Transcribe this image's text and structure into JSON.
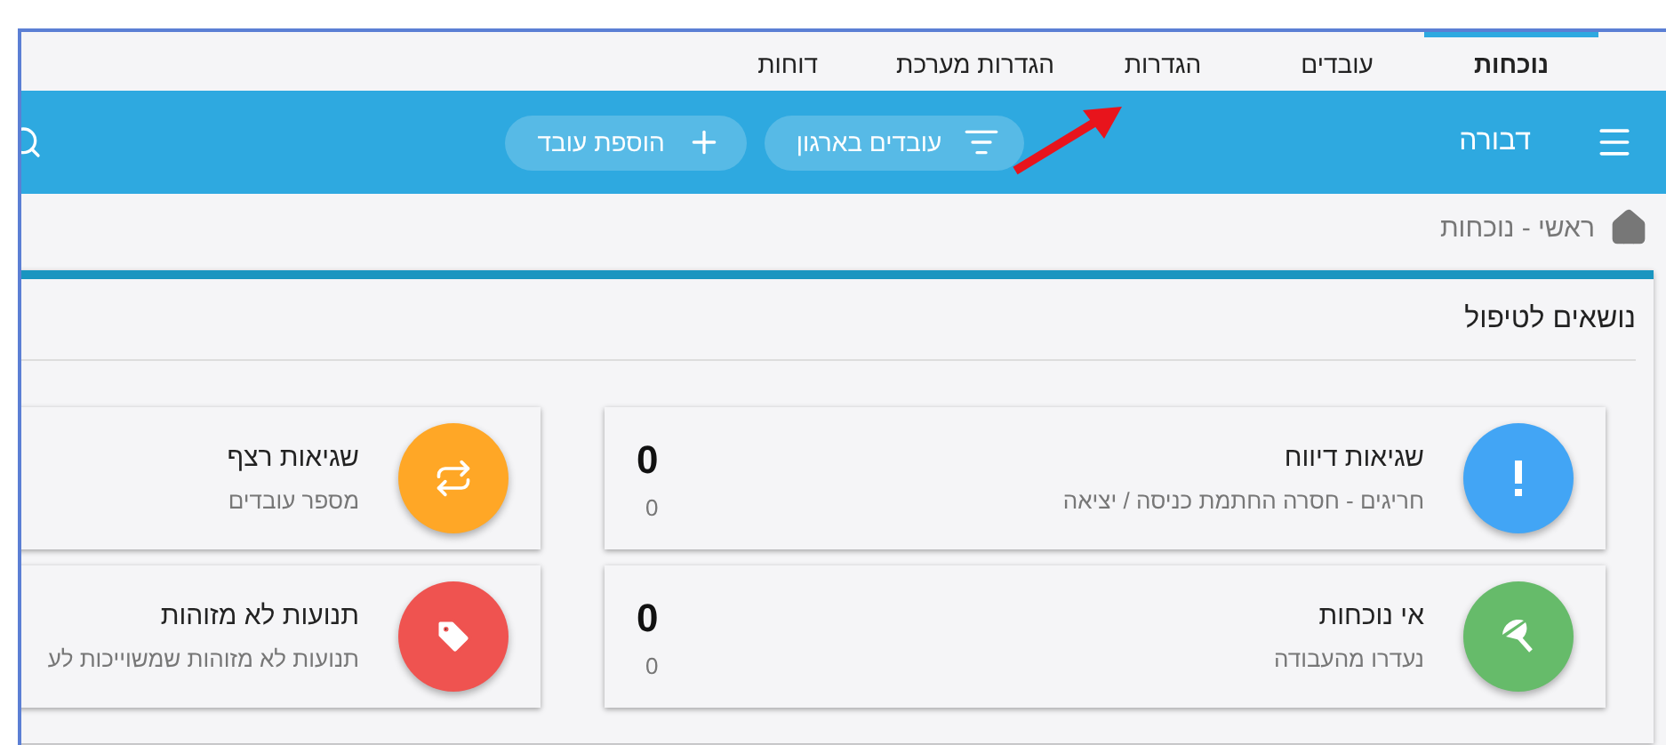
{
  "tabs": [
    {
      "label": "נוכחות",
      "selected": true
    },
    {
      "label": "עובדים",
      "selected": false
    },
    {
      "label": "הגדרות",
      "selected": false
    },
    {
      "label": "הגדרות מערכת",
      "selected": false
    },
    {
      "label": "דוחות",
      "selected": false
    }
  ],
  "toolbar": {
    "user": "דבורה",
    "buttons": [
      {
        "label": "עובדים בארגון",
        "kind": "filter"
      },
      {
        "label": "הוספת עובד",
        "kind": "add"
      }
    ]
  },
  "breadcrumb": "ראשי - נוכחות",
  "panel": {
    "title": "נושאים לטיפול",
    "items": [
      {
        "title": "שגיאות דיווח",
        "subtitle": "חריגים - חסרה החתמת כניסה / יציאה",
        "kind": "alert",
        "color": "#42a5f5",
        "count": "0",
        "count_sub": "0"
      },
      {
        "title": "שגיאות רצף",
        "subtitle": "מספר עובדים",
        "kind": "repeat",
        "color": "#ffa726"
      },
      {
        "title": "אי נוכחות",
        "subtitle": "נעדרו מהעבודה",
        "kind": "absence",
        "color": "#66bb6a",
        "count": "0",
        "count_sub": "0"
      },
      {
        "title": "תנועות לא מזוהות",
        "subtitle": "תנועות לא מזוהות שמשוייכות לע",
        "kind": "tag",
        "color": "#ef5350"
      }
    ]
  }
}
